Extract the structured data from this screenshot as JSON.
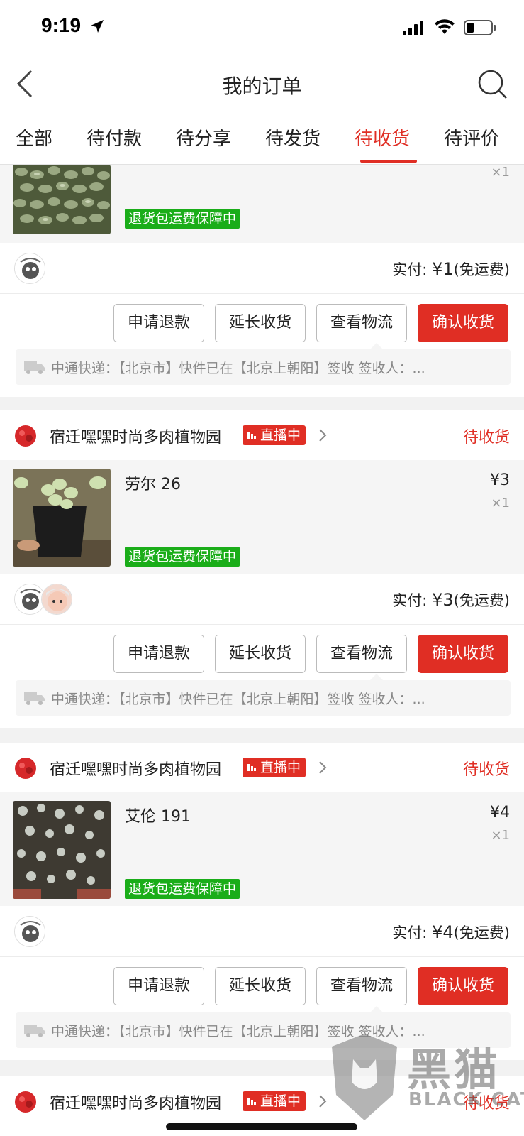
{
  "status_bar": {
    "time": "9:19"
  },
  "nav": {
    "title": "我的订单"
  },
  "tabs": [
    "全部",
    "待付款",
    "待分享",
    "待发货",
    "待收货",
    "待评价"
  ],
  "active_tab": "待收货",
  "colors": {
    "accent": "#e02e24",
    "guarantee": "#1aad19"
  },
  "labels": {
    "guarantee": "退货包运费保障中",
    "paid_prefix": "实付: ",
    "free_shipping": "(免运费)",
    "live": "直播中"
  },
  "buttons": {
    "refund": "申请退款",
    "extend": "延长收货",
    "logistics": "查看物流",
    "confirm": "确认收货"
  },
  "orders": [
    {
      "product_name": "",
      "price": "",
      "qty": "×1",
      "paid": "¥1",
      "logistics": "中通快递：【北京市】快件已在【北京上朝阳】签收 签收人：..."
    },
    {
      "shop_name": "宿迁嘿嘿时尚多肉植物园",
      "status": "待收货",
      "product_name": "劳尔 26",
      "price": "¥3",
      "qty": "×1",
      "paid": "¥3",
      "logistics": "中通快递：【北京市】快件已在【北京上朝阳】签收 签收人：..."
    },
    {
      "shop_name": "宿迁嘿嘿时尚多肉植物园",
      "status": "待收货",
      "product_name": "艾伦 191",
      "price": "¥4",
      "qty": "×1",
      "paid": "¥4",
      "logistics": "中通快递：【北京市】快件已在【北京上朝阳】签收 签收人：..."
    },
    {
      "shop_name": "宿迁嘿嘿时尚多肉植物园",
      "status": "待收货"
    }
  ],
  "watermark": {
    "cn": "黑猫",
    "en": "BLACK CAT"
  }
}
